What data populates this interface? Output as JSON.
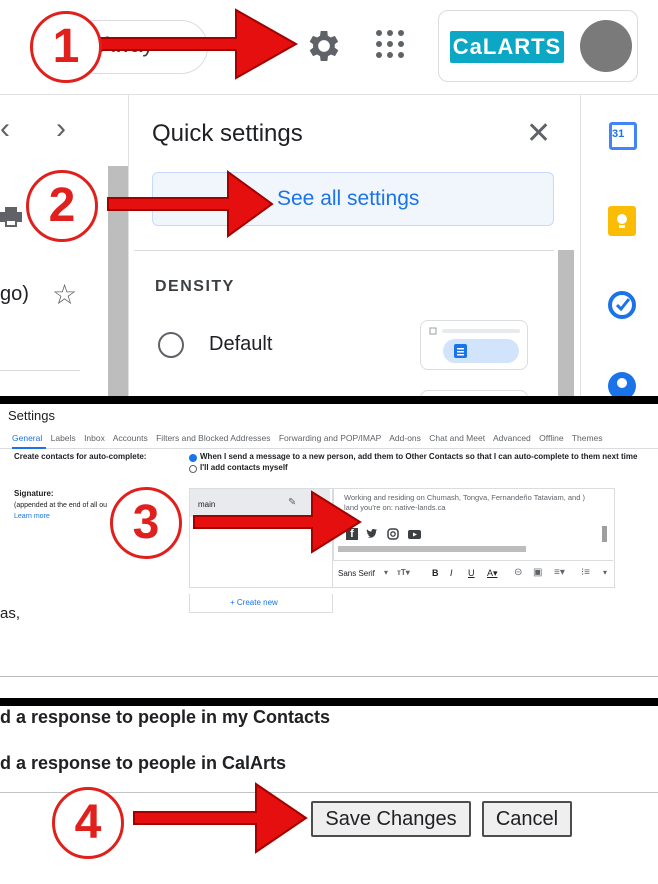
{
  "panel1": {
    "status": "Away",
    "account_logo": "CaLARTS",
    "left_text": "go)",
    "quick_settings": {
      "title": "Quick settings",
      "see_all": "See all settings",
      "density_heading": "DENSITY",
      "density_option": "Default"
    },
    "side_apps": [
      "calendar-icon",
      "keep-icon",
      "tasks-icon",
      "contacts-icon"
    ],
    "calendar_day": "31"
  },
  "panel2": {
    "title": "Settings",
    "tabs": [
      "General",
      "Labels",
      "Inbox",
      "Accounts",
      "Filters and Blocked Addresses",
      "Forwarding and POP/IMAP",
      "Add-ons",
      "Chat and Meet",
      "Advanced",
      "Offline",
      "Themes"
    ],
    "autocomplete_label": "Create contacts for auto-complete:",
    "autocomplete_opt1": "When I send a message to a new person, add them to Other Contacts so that I can auto-complete to them next time",
    "autocomplete_opt2": "I'll add contacts myself",
    "signature_label": "Signature:",
    "signature_note": "(appended at the end of all ou",
    "learn_more": "Learn more",
    "signature_name": "main",
    "signature_line1": "Working and residing on Chumash, Tongva, Fernandeño Tataviam, and )",
    "signature_line2": "land you're on: native-lands.ca",
    "font_name": "Sans Serif",
    "create_new": "+ Create new",
    "partial_text": "as,"
  },
  "panel3": {
    "response_contacts": "d a response to people in my Contacts",
    "response_calarts": "d a response to people in CalArts",
    "save_label": "Save Changes",
    "cancel_label": "Cancel"
  },
  "callouts": [
    "1",
    "2",
    "3",
    "4"
  ],
  "colors": {
    "callout_red": "#e0201c",
    "link_blue": "#1a73e8",
    "calarts_teal": "#0ba7c5"
  }
}
